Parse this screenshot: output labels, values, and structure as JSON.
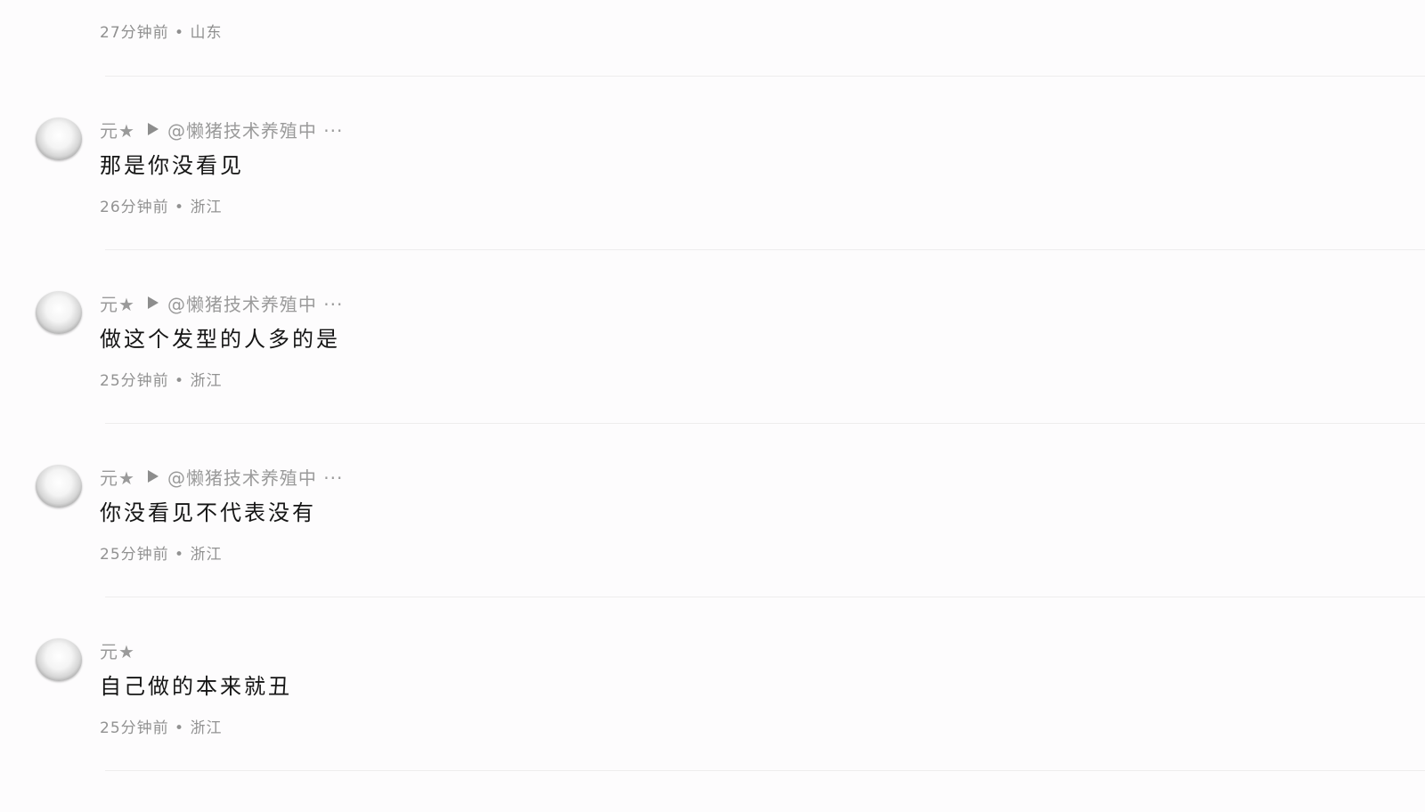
{
  "top_comment_meta": "27分钟前 • 山东",
  "comments": [
    {
      "author": "元★",
      "has_reply": true,
      "reply_to": "@懒猪技术养殖中 ···",
      "text": "那是你没看见",
      "meta": "26分钟前 • 浙江"
    },
    {
      "author": "元★",
      "has_reply": true,
      "reply_to": "@懒猪技术养殖中 ···",
      "text": "做这个发型的人多的是",
      "meta": "25分钟前 • 浙江"
    },
    {
      "author": "元★",
      "has_reply": true,
      "reply_to": "@懒猪技术养殖中 ···",
      "text": "你没看见不代表没有",
      "meta": "25分钟前 • 浙江"
    },
    {
      "author": "元★",
      "has_reply": false,
      "reply_to": "",
      "text": "自己做的本来就丑",
      "meta": "25分钟前 • 浙江"
    }
  ],
  "icons": {
    "avatar": "avatar-image",
    "reply": "reply-arrow-icon"
  },
  "colors": {
    "background": "#fdfcfd",
    "text_primary": "#151515",
    "text_secondary": "#929292",
    "divider": "#eeeded"
  }
}
